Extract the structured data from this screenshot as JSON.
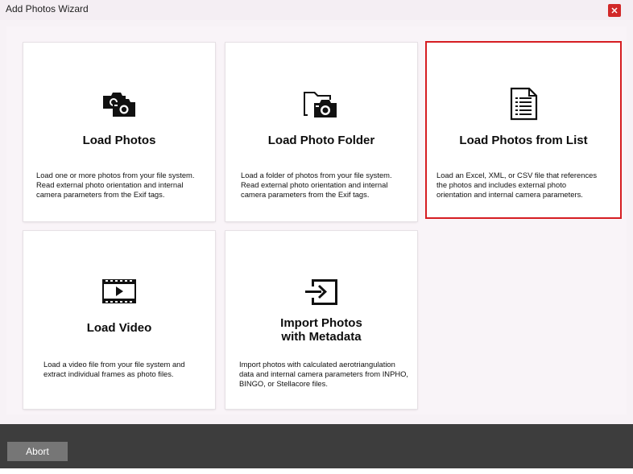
{
  "window": {
    "title": "Add Photos Wizard",
    "close_label": "×"
  },
  "cards": [
    {
      "title": "Load Photos",
      "description": "Load one or more photos from your file system. Read external photo orientation and internal camera parameters from the Exif tags.",
      "icon": "cameras-icon"
    },
    {
      "title": "Load Photo Folder",
      "description": "Load a folder of photos from your file system. Read external photo orientation and internal camera parameters from the Exif tags.",
      "icon": "folder-camera-icon"
    },
    {
      "title": "Load Photos from List",
      "description": "Load an Excel, XML, or CSV file that references the photos and includes external photo orientation and internal camera parameters.",
      "icon": "document-list-icon",
      "selected": true
    },
    {
      "title": "Load Video",
      "description": "Load a video file from your file system and extract individual frames as photo files.",
      "icon": "film-play-icon"
    },
    {
      "title": "Import Photos\nwith Metadata",
      "description": "Import photos with calculated aerotriangulation data and internal camera parameters from INPHO, BINGO, or Stellacore files.",
      "icon": "import-arrow-icon"
    }
  ],
  "footer": {
    "abort_label": "Abort"
  },
  "colors": {
    "selected_border": "#d61d22",
    "close_button": "#d12828",
    "footer_bg": "#3d3d3d",
    "button_bg": "#767676"
  }
}
